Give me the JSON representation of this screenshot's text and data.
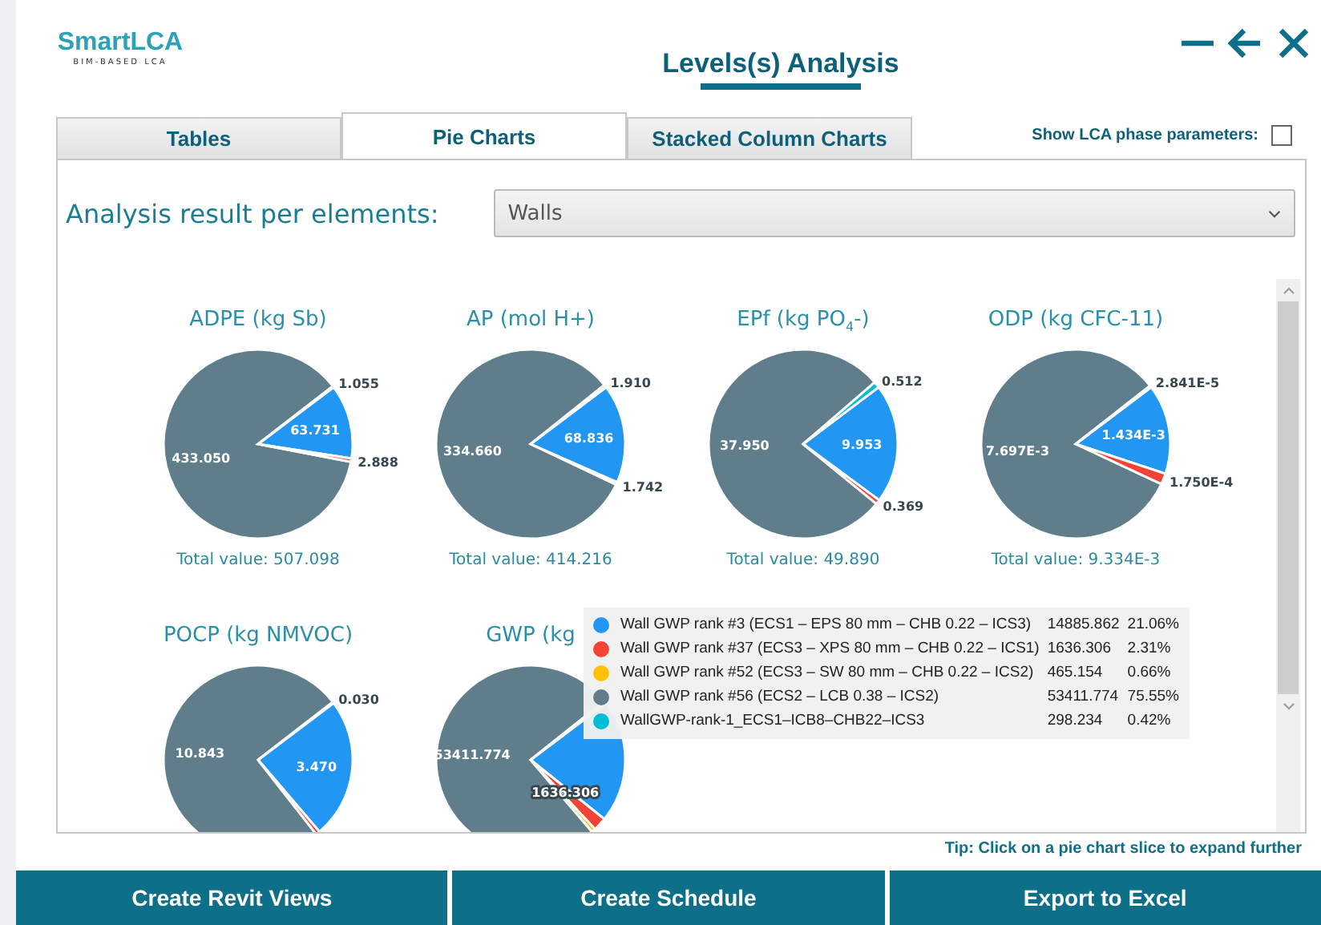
{
  "header": {
    "logo": "SmartLCA",
    "logo_subtitle": "BIM-BASED LCA",
    "title": "Levels(s) Analysis",
    "controls": [
      {
        "kind": "minimize"
      },
      {
        "kind": "back"
      },
      {
        "kind": "close"
      }
    ]
  },
  "tabs": [
    {
      "label": "Tables",
      "selected": false
    },
    {
      "label": "Pie Charts",
      "selected": true
    },
    {
      "label": "Stacked Column Charts",
      "selected": false
    }
  ],
  "phase_toggle": {
    "label": "Show LCA phase parameters:",
    "checked": false
  },
  "filter": {
    "label": "Analysis result per elements:",
    "value": "Walls"
  },
  "charts": [
    {
      "total": "Total value: 507.098",
      "chart_data": {
        "type": "pie",
        "title": "ADPE (kg Sb)",
        "values": [
          63.731,
          2.888,
          433.05,
          1.055
        ],
        "colors": [
          "#2196f3",
          "#f44336",
          "#607d8b",
          "#00bcd4"
        ],
        "value_labels": [
          "63.731",
          "2.888",
          "433.050",
          "1.055"
        ]
      }
    },
    {
      "total": "Total value: 414.216",
      "chart_data": {
        "type": "pie",
        "title": "AP (mol H+)",
        "values": [
          68.836,
          1.742,
          334.66,
          1.91
        ],
        "colors": [
          "#2196f3",
          "#f44336",
          "#607d8b",
          "#00bcd4"
        ],
        "value_labels": [
          "68.836",
          "1.742",
          "334.660",
          "1.910"
        ]
      }
    },
    {
      "total": "Total value: 49.890",
      "chart_data": {
        "type": "pie",
        "title": "EPf (kg PO$_{4}$-)",
        "values": [
          9.953,
          0.369,
          37.95,
          0.512
        ],
        "colors": [
          "#2196f3",
          "#f44336",
          "#607d8b",
          "#00bcd4"
        ],
        "value_labels": [
          "9.953",
          "0.369",
          "37.950",
          "0.512"
        ]
      }
    },
    {
      "total": "Total value: 9.334E-3",
      "chart_data": {
        "type": "pie",
        "title": "ODP (kg CFC-11)",
        "values": [
          0.001434,
          0.000175,
          0.007697,
          2.841e-05
        ],
        "colors": [
          "#2196f3",
          "#f44336",
          "#607d8b",
          "#00bcd4"
        ],
        "value_labels": [
          "1.434E-3",
          "1.750E-4",
          "7.697E-3",
          "2.841E-5"
        ]
      }
    },
    {
      "chart_data": {
        "type": "pie",
        "title": "POCP (kg NMVOC)",
        "values": [
          3.47,
          0.1,
          10.843,
          0.03
        ],
        "colors": [
          "#2196f3",
          "#f44336",
          "#607d8b",
          "#00bcd4"
        ],
        "value_labels": [
          "3.470",
          null,
          "10.843",
          "0.030"
        ]
      }
    },
    {
      "chart_data": {
        "type": "pie",
        "title": "GWP (kg",
        "values": [
          14885.862,
          1636.306,
          465.154,
          53411.774,
          298.234
        ],
        "colors": [
          "#2196f3",
          "#f44336",
          "#ffc107",
          "#607d8b",
          "#00bcd4"
        ],
        "value_labels": [
          null,
          "1636.306",
          null,
          "53411.774",
          null
        ]
      },
      "tooltip": [
        {
          "name": "Wall GWP rank #3 (ECS1 – EPS 80 mm – CHB 0.22 – ICS3)",
          "value": "14885.862",
          "percent": "21.06%",
          "color": "#2196f3"
        },
        {
          "name": "Wall GWP rank #37 (ECS3 – XPS 80 mm – CHB 0.22 – ICS1)",
          "value": "1636.306",
          "percent": "2.31%",
          "color": "#f44336"
        },
        {
          "name": "Wall GWP rank #52 (ECS3 – SW 80 mm – CHB 0.22 – ICS2)",
          "value": "465.154",
          "percent": "0.66%",
          "color": "#ffc107"
        },
        {
          "name": "Wall GWP rank #56 (ECS2 – LCB 0.38 – ICS2)",
          "value": "53411.774",
          "percent": "75.55%",
          "color": "#607d8b"
        },
        {
          "name": "WallGWP-rank-1_ECS1–ICB8–CHB22–ICS3",
          "value": "298.234",
          "percent": "0.42%",
          "color": "#00bcd4"
        }
      ]
    }
  ],
  "tip": "Tip: Click on a pie chart slice to expand further",
  "buttons": [
    "Create Revit Views",
    "Create Schedule",
    "Export to Excel"
  ]
}
